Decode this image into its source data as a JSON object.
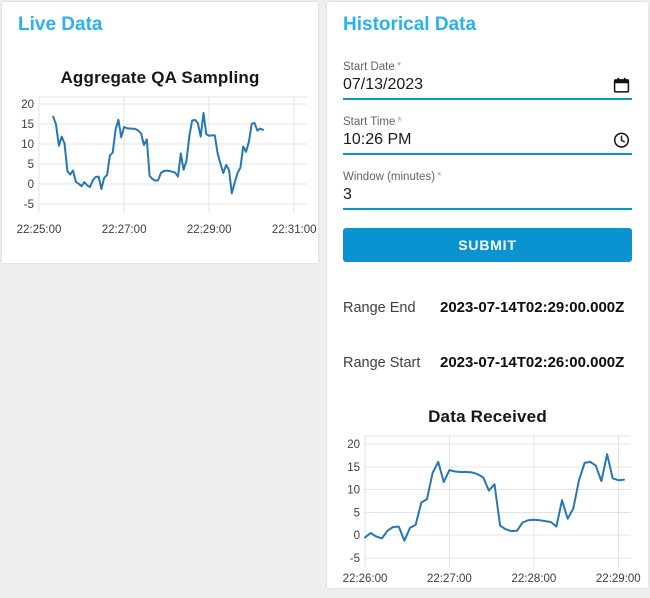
{
  "colors": {
    "header_blue": "#29b1f0",
    "primary_blue": "#0a94d1",
    "line_blue": "#2677b8",
    "grid_gray": "#e3e3e3",
    "page_background": "#edeff0"
  },
  "live_panel": {
    "title": "Live Data"
  },
  "historical_panel": {
    "title": "Historical Data",
    "fields": [
      {
        "label": "Start Date",
        "required_marker": "*",
        "value": "07/13/2023",
        "icon": "calendar-icon"
      },
      {
        "label": "Start Time",
        "required_marker": "*",
        "value": "10:26 PM",
        "icon": "clock-icon"
      },
      {
        "label": "Window (minutes)",
        "required_marker": "*",
        "value": "3",
        "icon": "none"
      }
    ],
    "submit_label": "SUBMIT",
    "range_end": {
      "label": "Range End",
      "value": "2023-07-14T02:29:00.000Z"
    },
    "range_start": {
      "label": "Range Start",
      "value": "2023-07-14T02:26:00.000Z"
    }
  },
  "chart_data": [
    {
      "type": "line",
      "title": "Aggregate QA Sampling",
      "xlabel": "",
      "ylabel": "",
      "grid": true,
      "legend": "none",
      "x_tick_labels": [
        "22:25:00",
        "22:27:00",
        "22:29:00",
        "22:31:00"
      ],
      "x_tick_values": [
        0,
        120,
        240,
        360
      ],
      "y_ticks": [
        -5,
        0,
        5,
        10,
        15,
        20
      ],
      "x_range": [
        0,
        378
      ],
      "y_range": [
        -7.2,
        21.8
      ],
      "x_unit": "seconds after 22:25:00",
      "line_color": "#2677b8",
      "series": [
        {
          "name": "aggregate-qa-sampling",
          "x_start_s": 20,
          "x_step_s": 4,
          "values": [
            16.9,
            14.9,
            9.6,
            11.9,
            10.2,
            3.3,
            2.4,
            3.4,
            0.6,
            0.1,
            -0.5,
            0.5,
            -0.3,
            -0.7,
            1.0,
            1.8,
            1.9,
            -1.2,
            1.6,
            2.3,
            7.2,
            7.9,
            13.7,
            16.1,
            11.7,
            14.3,
            14.0,
            13.9,
            13.9,
            13.8,
            13.4,
            12.7,
            9.8,
            11.2,
            2.1,
            1.3,
            0.9,
            1.0,
            2.8,
            3.3,
            3.4,
            3.3,
            3.1,
            2.9,
            1.9,
            7.7,
            3.6,
            5.9,
            12.0,
            15.9,
            16.1,
            15.3,
            11.9,
            17.8,
            12.5,
            12.1,
            12.2,
            12.2,
            7.6,
            5.1,
            2.8,
            4.8,
            3.6,
            -2.3,
            0.4,
            2.8,
            4.1,
            9.4,
            8.1,
            10.6,
            15.1,
            15.3,
            13.4,
            13.9,
            13.6
          ]
        }
      ]
    },
    {
      "type": "line",
      "title": "Data Received",
      "xlabel": "",
      "ylabel": "",
      "grid": true,
      "legend": "none",
      "x_tick_labels": [
        "22:26:00",
        "22:27:00",
        "22:28:00",
        "22:29:00"
      ],
      "x_tick_values": [
        0,
        60,
        120,
        180
      ],
      "y_ticks": [
        -5,
        0,
        5,
        10,
        15,
        20
      ],
      "x_range": [
        0,
        189
      ],
      "y_range": [
        -7.2,
        21.8
      ],
      "x_unit": "seconds after 22:26:00",
      "line_color": "#2677b8",
      "series": [
        {
          "name": "data-received",
          "x_start_s": 0,
          "x_step_s": 4,
          "values": [
            -0.5,
            0.5,
            -0.3,
            -0.7,
            1.0,
            1.8,
            1.9,
            -1.2,
            1.6,
            2.3,
            7.2,
            7.9,
            13.7,
            16.1,
            11.7,
            14.3,
            14.0,
            13.9,
            13.9,
            13.8,
            13.4,
            12.7,
            9.8,
            11.2,
            2.1,
            1.3,
            0.9,
            1.0,
            2.8,
            3.3,
            3.4,
            3.3,
            3.1,
            2.9,
            1.9,
            7.7,
            3.6,
            5.9,
            12.0,
            15.9,
            16.1,
            15.3,
            11.9,
            17.8,
            12.5,
            12.1,
            12.2
          ]
        }
      ]
    }
  ]
}
